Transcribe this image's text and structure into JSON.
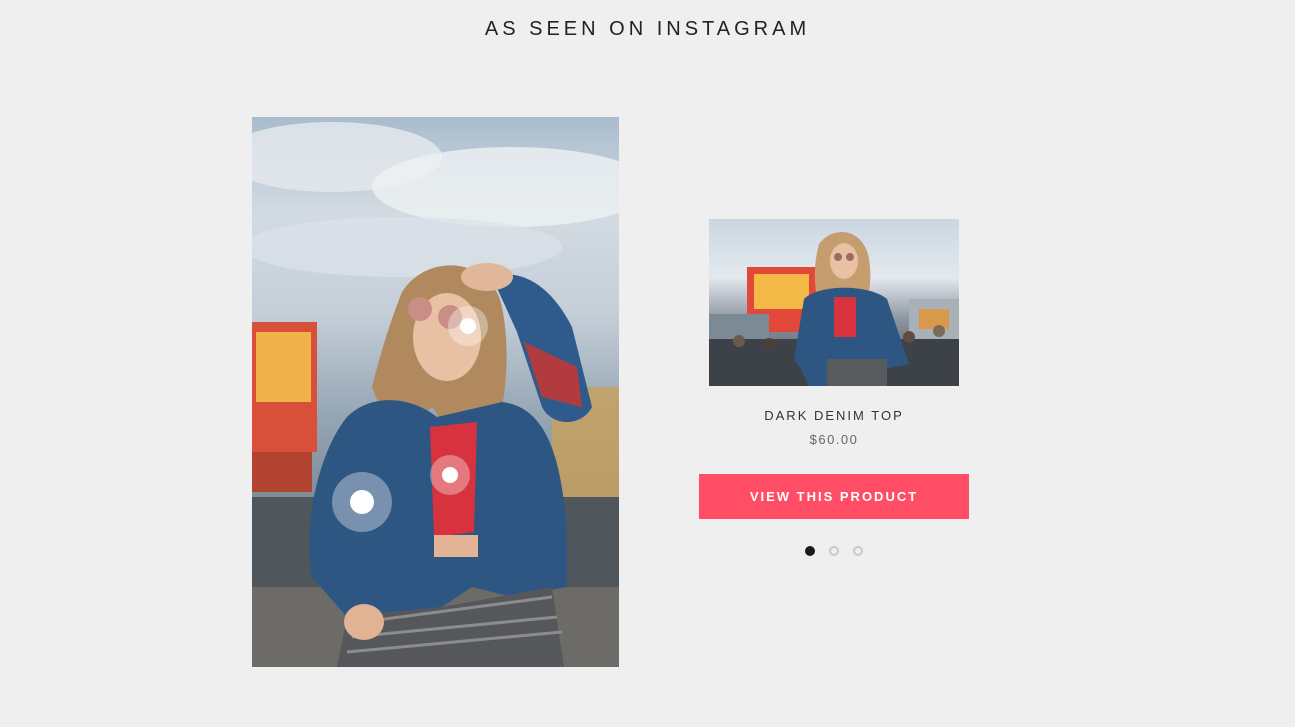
{
  "section": {
    "title": "AS SEEN ON INSTAGRAM"
  },
  "lookbook": {
    "hotspots": [
      {
        "name": "sunglasses"
      },
      {
        "name": "red-top"
      },
      {
        "name": "denim-jacket"
      }
    ]
  },
  "product": {
    "name": "DARK DENIM TOP",
    "price": "$60.00",
    "button_label": "VIEW THIS PRODUCT"
  },
  "pagination": {
    "count": 3,
    "active_index": 0
  },
  "colors": {
    "background": "#efefef",
    "accent": "#fe4d65",
    "pager_active": "#1a1a1a",
    "pager_inactive": "#c8c8c8"
  }
}
